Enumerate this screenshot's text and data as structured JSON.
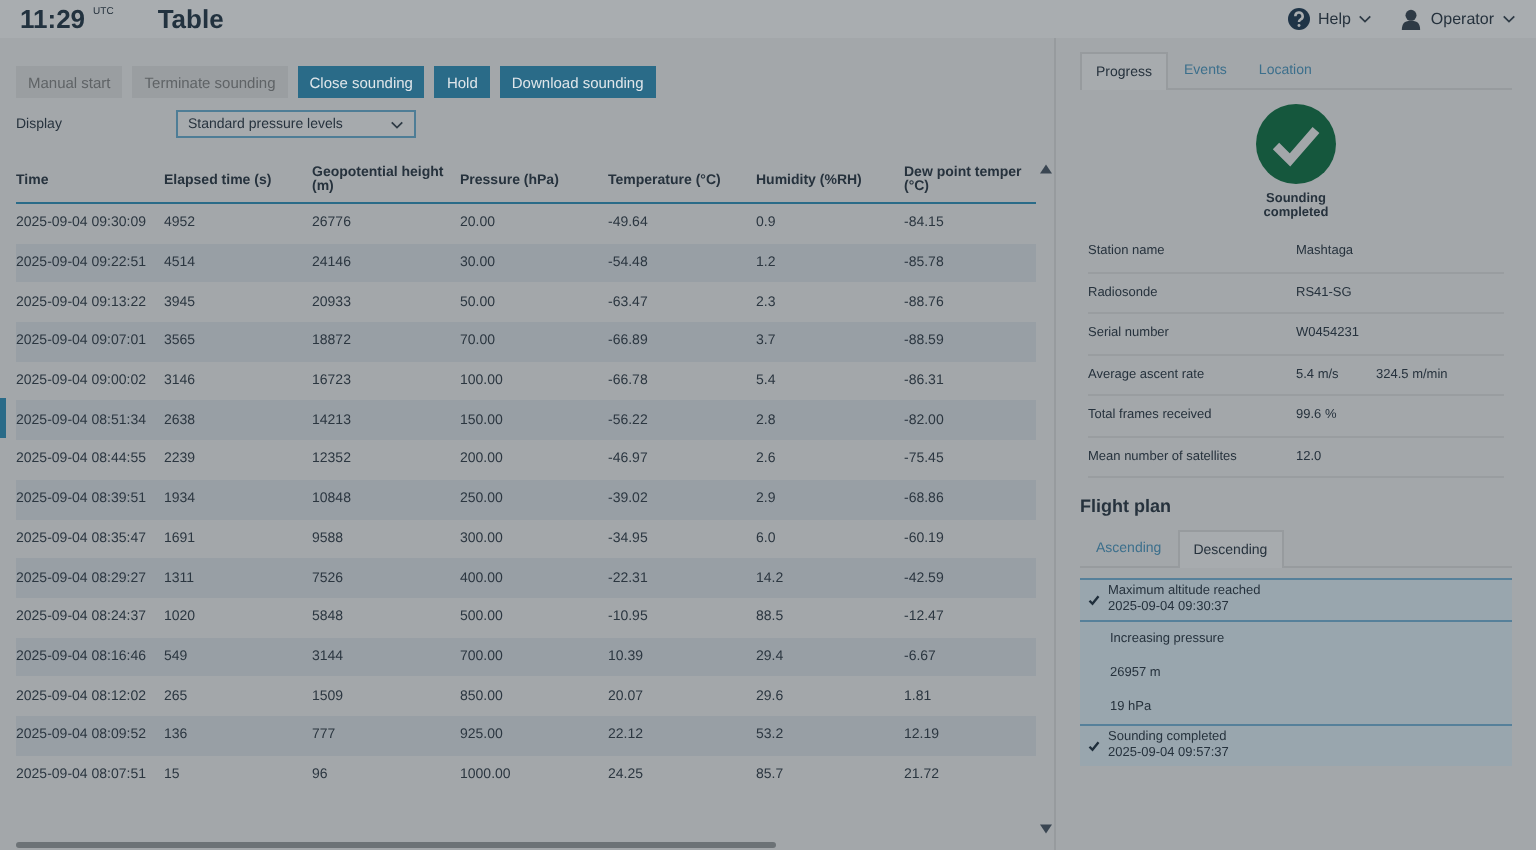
{
  "header": {
    "time": "11:29",
    "time_zone": "UTC",
    "title": "Table",
    "help": "Help",
    "user": "Operator"
  },
  "actions": [
    {
      "label": "Manual start",
      "disabled": true
    },
    {
      "label": "Terminate sounding",
      "disabled": true
    },
    {
      "label": "Close sounding",
      "disabled": false
    },
    {
      "label": "Hold",
      "disabled": false
    },
    {
      "label": "Download sounding",
      "disabled": false
    }
  ],
  "display": {
    "label": "Display",
    "value": "Standard pressure levels"
  },
  "table": {
    "columns": [
      "Time",
      "Elapsed time (s)",
      "Geopotential height (m)",
      "Pressure (hPa)",
      "Temperature (°C)",
      "Humidity (%RH)",
      "Dew point temper (°C)"
    ],
    "rows": [
      [
        "2025-09-04 09:30:09",
        "4952",
        "26776",
        "20.00",
        "-49.64",
        "0.9",
        "-84.15"
      ],
      [
        "2025-09-04 09:22:51",
        "4514",
        "24146",
        "30.00",
        "-54.48",
        "1.2",
        "-85.78"
      ],
      [
        "2025-09-04 09:13:22",
        "3945",
        "20933",
        "50.00",
        "-63.47",
        "2.3",
        "-88.76"
      ],
      [
        "2025-09-04 09:07:01",
        "3565",
        "18872",
        "70.00",
        "-66.89",
        "3.7",
        "-88.59"
      ],
      [
        "2025-09-04 09:00:02",
        "3146",
        "16723",
        "100.00",
        "-66.78",
        "5.4",
        "-86.31"
      ],
      [
        "2025-09-04 08:51:34",
        "2638",
        "14213",
        "150.00",
        "-56.22",
        "2.8",
        "-82.00"
      ],
      [
        "2025-09-04 08:44:55",
        "2239",
        "12352",
        "200.00",
        "-46.97",
        "2.6",
        "-75.45"
      ],
      [
        "2025-09-04 08:39:51",
        "1934",
        "10848",
        "250.00",
        "-39.02",
        "2.9",
        "-68.86"
      ],
      [
        "2025-09-04 08:35:47",
        "1691",
        "9588",
        "300.00",
        "-34.95",
        "6.0",
        "-60.19"
      ],
      [
        "2025-09-04 08:29:27",
        "1311",
        "7526",
        "400.00",
        "-22.31",
        "14.2",
        "-42.59"
      ],
      [
        "2025-09-04 08:24:37",
        "1020",
        "5848",
        "500.00",
        "-10.95",
        "88.5",
        "-12.47"
      ],
      [
        "2025-09-04 08:16:46",
        "549",
        "3144",
        "700.00",
        "10.39",
        "29.4",
        "-6.67"
      ],
      [
        "2025-09-04 08:12:02",
        "265",
        "1509",
        "850.00",
        "20.07",
        "29.6",
        "1.81"
      ],
      [
        "2025-09-04 08:09:52",
        "136",
        "777",
        "925.00",
        "22.12",
        "53.2",
        "12.19"
      ],
      [
        "2025-09-04 08:07:51",
        "15",
        "96",
        "1000.00",
        "24.25",
        "85.7",
        "21.72"
      ]
    ]
  },
  "side_tabs": [
    {
      "label": "Progress",
      "selected": true
    },
    {
      "label": "Events",
      "selected": false
    },
    {
      "label": "Location",
      "selected": false
    }
  ],
  "status": {
    "label": "Sounding completed"
  },
  "details": [
    {
      "label": "Station name",
      "values": [
        "Mashtaga"
      ]
    },
    {
      "label": "Radiosonde",
      "values": [
        "RS41-SG"
      ]
    },
    {
      "label": "Serial number",
      "values": [
        "W0454231"
      ]
    },
    {
      "label": "Average ascent rate",
      "values": [
        "5.4 m/s",
        "324.5 m/min"
      ]
    },
    {
      "label": "Total frames received",
      "values": [
        "99.6 %"
      ]
    },
    {
      "label": "Mean number of satellites",
      "values": [
        "12.0"
      ]
    }
  ],
  "flight_plan": {
    "title": "Flight plan",
    "tabs": [
      {
        "label": "Ascending",
        "selected": false
      },
      {
        "label": "Descending",
        "selected": true
      }
    ],
    "items": [
      {
        "kind": "milestone",
        "done": true,
        "title": "Maximum altitude reached",
        "time": "2025-09-04 09:30:37"
      },
      {
        "kind": "detail",
        "text": "Increasing pressure"
      },
      {
        "kind": "detail",
        "text": "26957 m"
      },
      {
        "kind": "detail",
        "text": "19 hPa"
      },
      {
        "kind": "milestone",
        "done": true,
        "title": "Sounding completed",
        "time": "2025-09-04 09:57:37"
      }
    ]
  }
}
